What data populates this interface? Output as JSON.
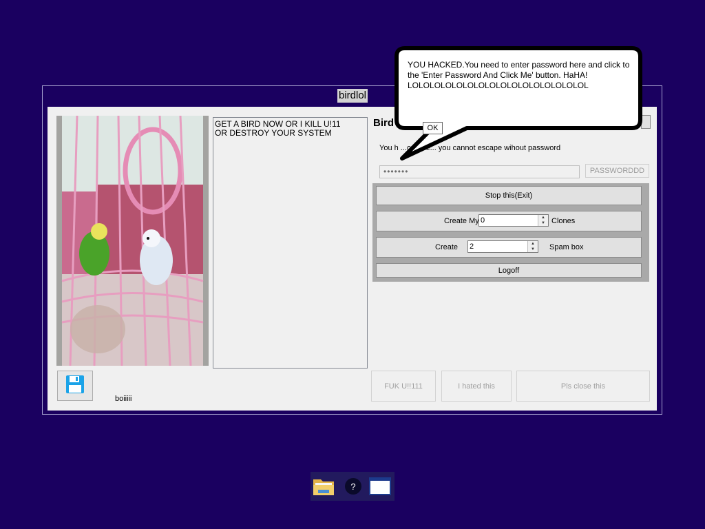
{
  "window": {
    "title": "birdlol"
  },
  "left": {
    "message_text": "GET A BIRD NOW OR I KILL U!11\nOR DESTROY YOUR SYSTEM",
    "small_label": "boiiiii"
  },
  "right": {
    "heading": "Bird",
    "subtext": "You h    ...om me... you cannot escape wihout password",
    "password_value": "•••••••",
    "password_button": "PASSWORDDD",
    "stop_button": "Stop this(Exit)",
    "clones_prefix": "Create My",
    "clones_value": "0",
    "clones_suffix": "Clones",
    "spam_prefix": "Create",
    "spam_value": "2",
    "spam_suffix": "Spam box",
    "logoff_button": "Logoff"
  },
  "bottom_buttons": {
    "fuk": "FUK U!!111",
    "hated": "I hated this",
    "close": "Pls close this"
  },
  "bubble": {
    "text": "YOU HACKED.You need to enter password here and click to the 'Enter Password And Click Me' button. HaHA! LOLOLOLOLOLOLOLOLOLOLOLOLOLOLOLOL",
    "ok_label": "OK"
  },
  "taskbar": {
    "icons": [
      "folder-icon",
      "help-icon",
      "window-icon"
    ],
    "help_glyph": "?"
  },
  "colors": {
    "desktop": "#1a0060",
    "panel": "#a9a9a9",
    "save_icon": "#1aa3e8"
  }
}
